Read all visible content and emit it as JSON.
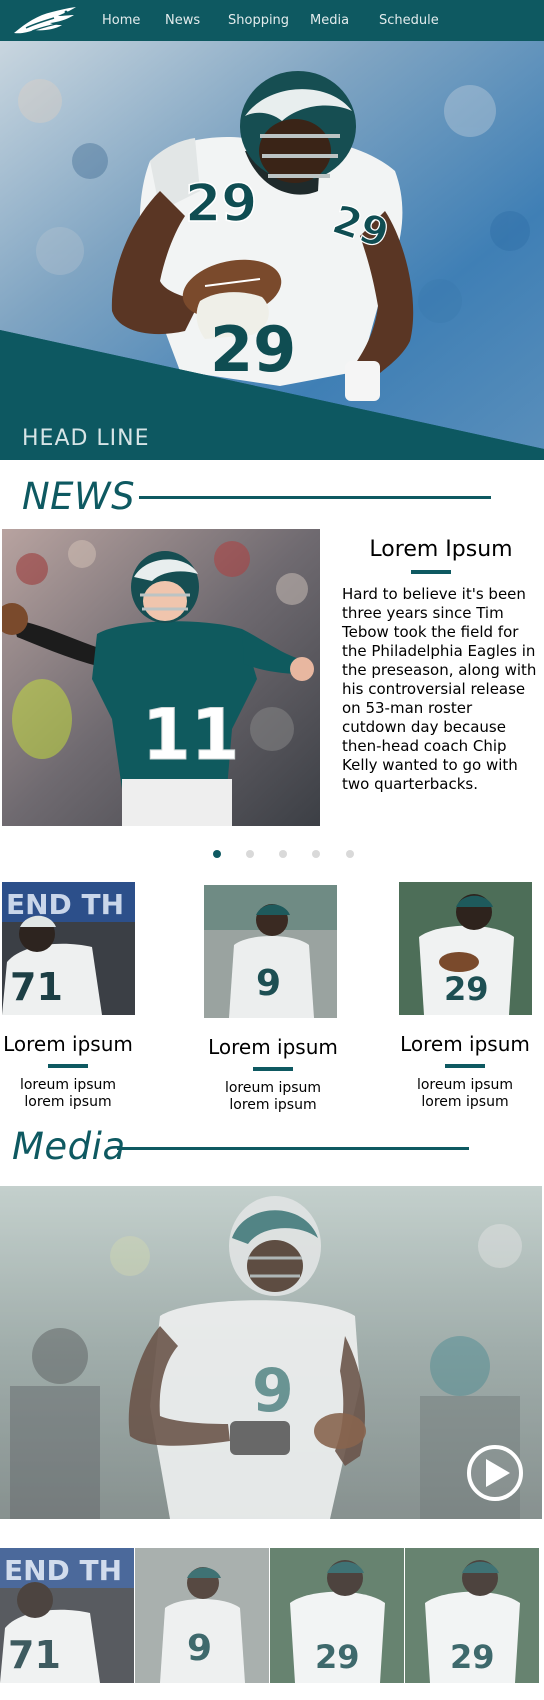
{
  "nav": {
    "logo_icon": "eagle-logo-icon",
    "items": [
      {
        "label": "Home"
      },
      {
        "label": "News"
      },
      {
        "label": "Shopping"
      },
      {
        "label": "Media"
      },
      {
        "label": "Schedule"
      }
    ]
  },
  "hero": {
    "headline": "HEAD LINE",
    "jersey_number": "29"
  },
  "news": {
    "title": "NEWS",
    "featured": {
      "title": "Lorem Ipsum",
      "jersey_number": "11",
      "body": "Hard to believe it's been three years since Tim Tebow took the field for the Philadelphia Eagles in the preseason, along with his controversial release on 53-man roster cutdown day because then-head coach Chip Kelly wanted to go with two quarterbacks."
    },
    "carousel": {
      "count": 5,
      "active": 1
    },
    "cards": [
      {
        "jersey_number": "71",
        "title": "Lorem ipsum",
        "line1": "loreum ipsum",
        "line2": "lorem ipsum"
      },
      {
        "jersey_number": "9",
        "title": "Lorem ipsum",
        "line1": "loreum ipsum",
        "line2": "lorem ipsum"
      },
      {
        "jersey_number": "29",
        "title": "Lorem ipsum",
        "line1": "loreum ipsum",
        "line2": "lorem ipsum"
      }
    ]
  },
  "media": {
    "title": "Media",
    "video": {
      "jersey_number": "9",
      "play_icon": "play-icon"
    },
    "thumbnails": [
      {
        "jersey_number": "71"
      },
      {
        "jersey_number": "9"
      },
      {
        "jersey_number": "29"
      },
      {
        "jersey_number": "29"
      }
    ]
  },
  "colors": {
    "brand": "#0e5961",
    "nav_text": "#e3eced",
    "dot_inactive": "#d9d9d9"
  }
}
